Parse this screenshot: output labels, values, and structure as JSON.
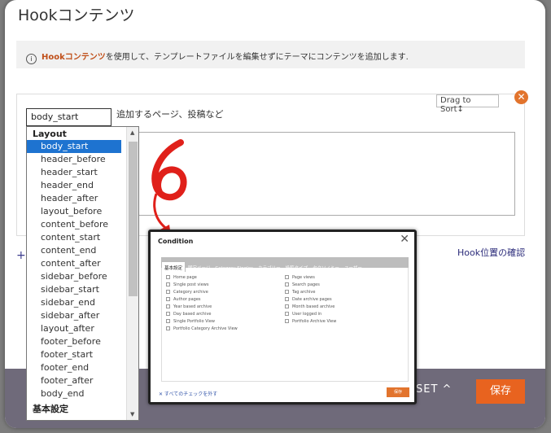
{
  "page": {
    "title": "Hookコンテンツ",
    "notice_icon": "i",
    "notice_brand": "Hookコンテンツ",
    "notice_text": "を使用して、テンプレートファイルを編集せずにテーマにコンテンツを追加します."
  },
  "card": {
    "drag_sort": "Drag to Sort↕",
    "close_symbol": "✕",
    "select_value": "body_start",
    "hint": "追加するページ、投稿など"
  },
  "plus": "+",
  "hook_link": "Hook位置の確認",
  "footer": {
    "reset_label": "SET ^",
    "save_label": "保存"
  },
  "dropdown": {
    "group_layout": "Layout",
    "items": [
      "body_start",
      "header_before",
      "header_start",
      "header_end",
      "header_after",
      "layout_before",
      "content_before",
      "content_start",
      "content_end",
      "content_after",
      "sidebar_before",
      "sidebar_start",
      "sidebar_end",
      "sidebar_after",
      "layout_after",
      "footer_before",
      "footer_start",
      "footer_end",
      "footer_after",
      "body_end"
    ],
    "group_basic": "基本設定"
  },
  "annotation": {
    "number": "6",
    "color": "#e0201a"
  },
  "modal": {
    "title": "Condition",
    "close": "✕",
    "tabs": [
      "基本設定",
      "固定ページ",
      "Category Singles",
      "カテゴリー",
      "投稿タイプ",
      "タクソノミー",
      "ユーザー"
    ],
    "left_options": [
      "Home page",
      "Single post views",
      "Category archive",
      "Author pages",
      "Year based archive",
      "Day based archive",
      "Single Portfolio View",
      "Portfolio Category Archive View"
    ],
    "right_options": [
      "Page views",
      "Search pages",
      "Tag archive",
      "Date archive pages",
      "Month based archive",
      "User logged in",
      "Portfolio Archive View"
    ],
    "uncheck_all": "✕ すべてのチェックを外す",
    "save": "保存"
  }
}
